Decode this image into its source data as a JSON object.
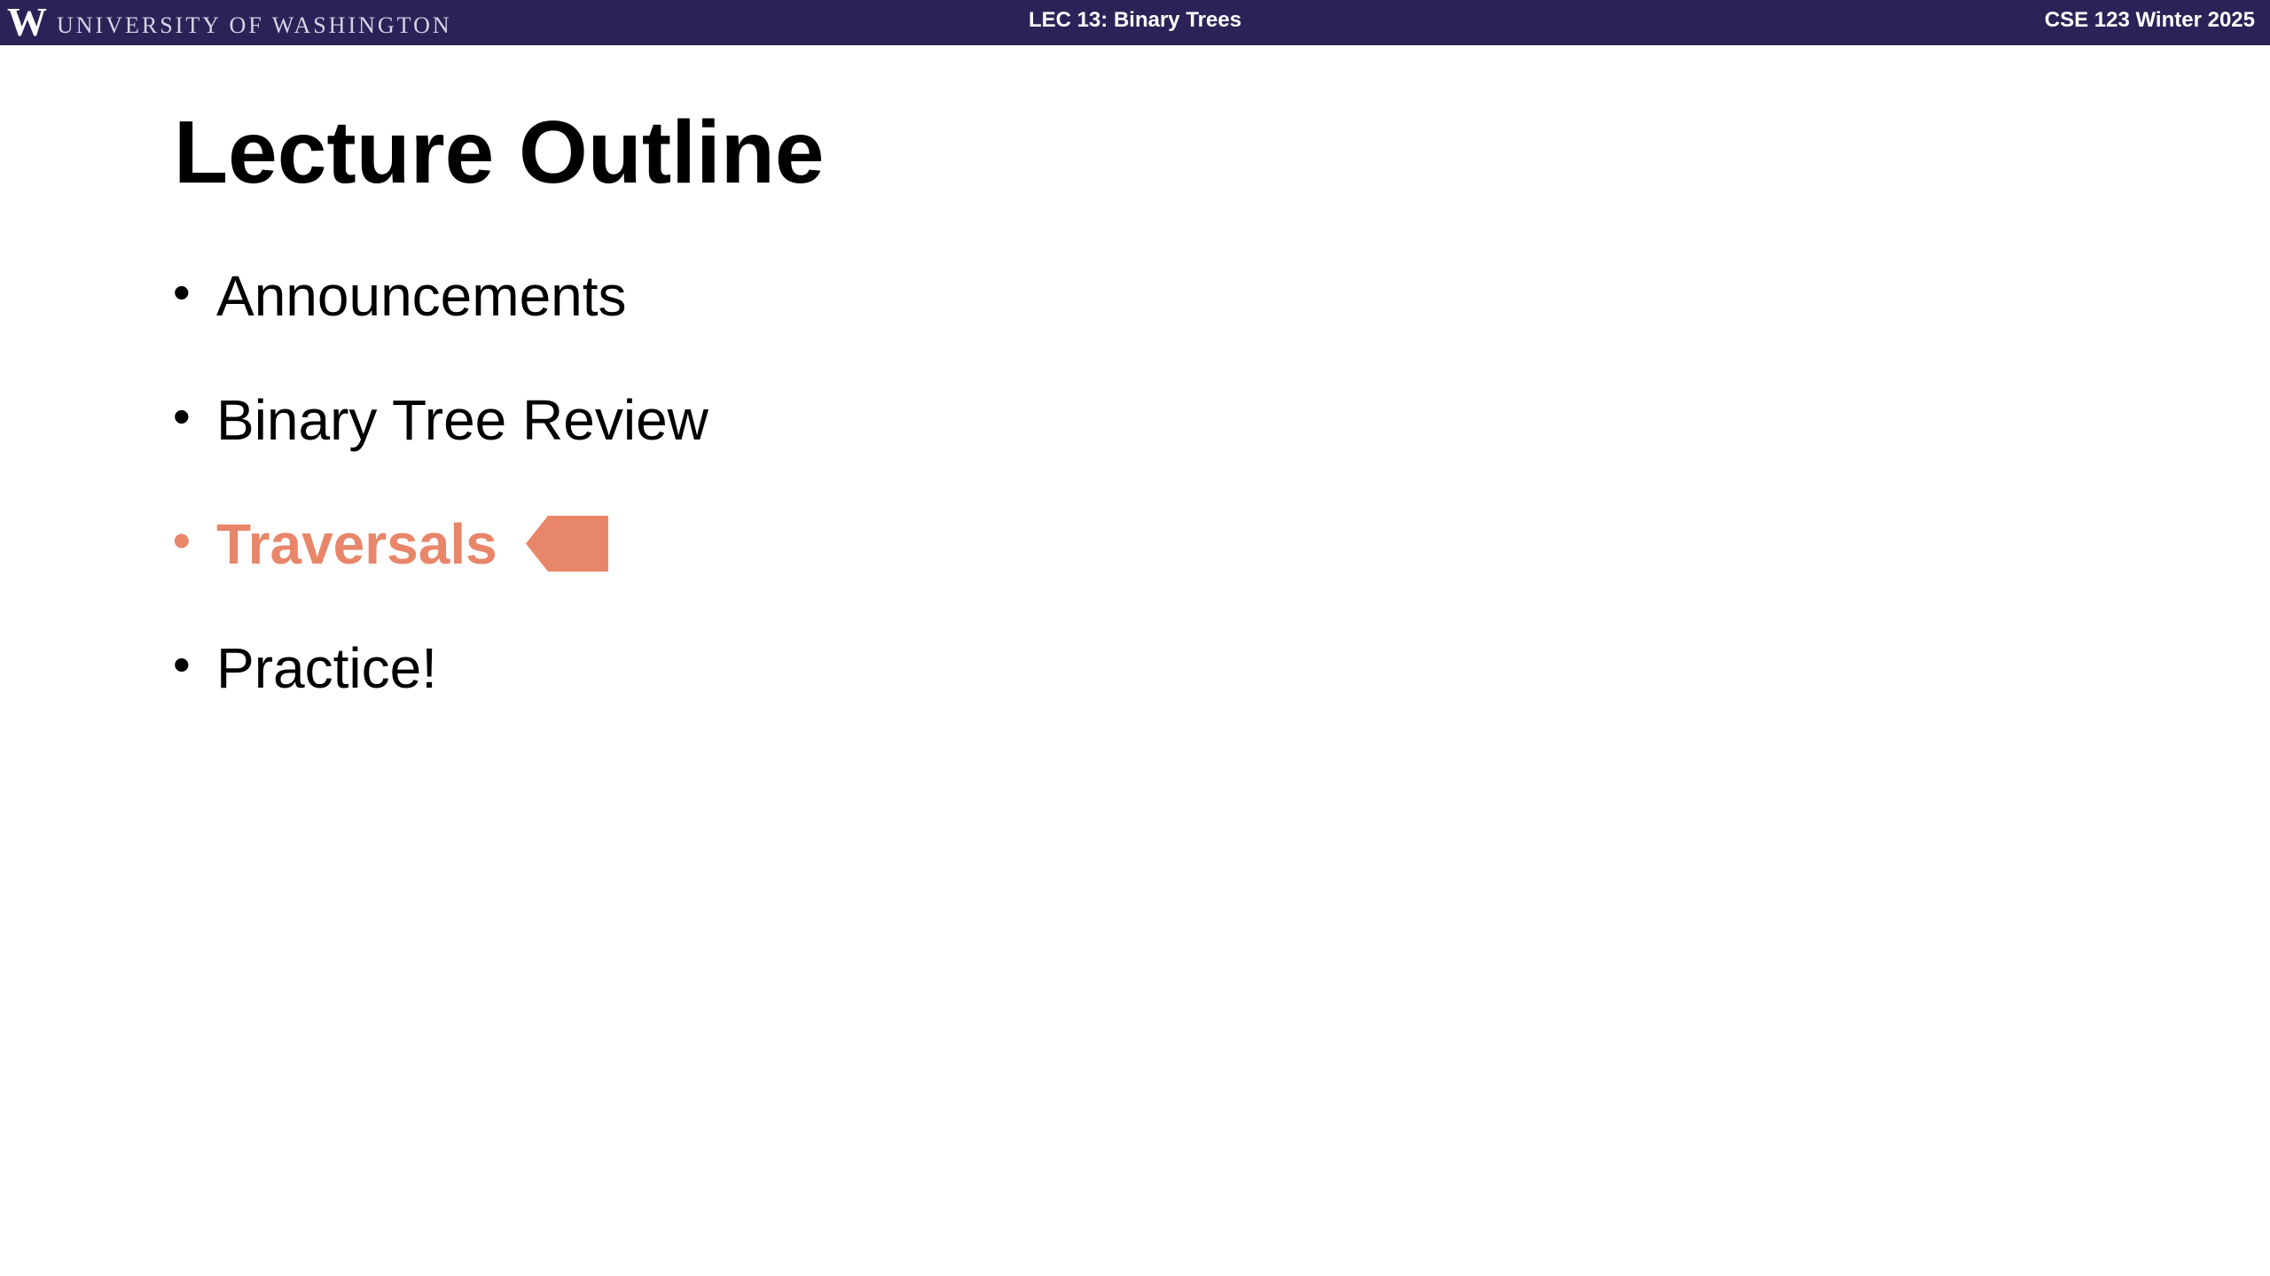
{
  "header": {
    "university_logo_letter": "W",
    "university_name": "UNIVERSITY of WASHINGTON",
    "lecture_title": "LEC 13: Binary Trees",
    "course_title": "CSE 123 Winter 2025"
  },
  "slide": {
    "title": "Lecture Outline",
    "items": [
      {
        "label": "Announcements"
      },
      {
        "label": "Binary Tree Review"
      },
      {
        "label": "Traversals",
        "current": true
      },
      {
        "label": "Practice!"
      }
    ]
  },
  "colors": {
    "header_background": "#2d2257",
    "current_item": "#e8866a",
    "text": "#000000",
    "background": "#ffffff"
  },
  "icons": {
    "university_logo": "uw-w-logo",
    "current_section_marker": "left-arrow-marker-icon",
    "bullet": "bullet-dot-icon"
  }
}
